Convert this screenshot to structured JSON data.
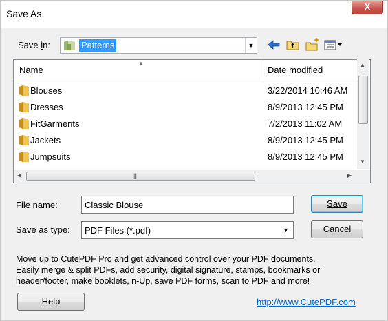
{
  "window": {
    "title": "Save As",
    "close_label": "X"
  },
  "save_in": {
    "label": "Save in:",
    "value": "Patterns"
  },
  "toolbar": {
    "icons": [
      "back-arrow-icon",
      "up-folder-icon",
      "new-folder-icon",
      "view-menu-icon"
    ]
  },
  "file_list": {
    "columns": [
      "Name",
      "Date modified"
    ],
    "rows": [
      {
        "name": "Blouses",
        "date": "3/22/2014 10:46 AM"
      },
      {
        "name": "Dresses",
        "date": "8/9/2013 12:45 PM"
      },
      {
        "name": "FitGarments",
        "date": "7/2/2013 11:02 AM"
      },
      {
        "name": "Jackets",
        "date": "8/9/2013 12:45 PM"
      },
      {
        "name": "Jumpsuits",
        "date": "8/9/2013 12:45 PM"
      }
    ]
  },
  "file_name": {
    "label": "File name:",
    "value": "Classic Blouse"
  },
  "save_type": {
    "label": "Save as type:",
    "value": "PDF Files (*.pdf)"
  },
  "buttons": {
    "save": "Save",
    "cancel": "Cancel",
    "help": "Help"
  },
  "promo": {
    "lines": [
      "Move up to CutePDF Pro and get advanced control over your PDF documents.",
      "Easily merge & split PDFs, add security, digital signature, stamps, bookmarks or",
      "header/footer, make booklets, n-Up, save PDF forms, scan to PDF and more!"
    ],
    "link": "http://www.CutePDF.com"
  },
  "colors": {
    "selection": "#3399ff",
    "folder": "#e8b84a",
    "link": "#0066cc"
  }
}
